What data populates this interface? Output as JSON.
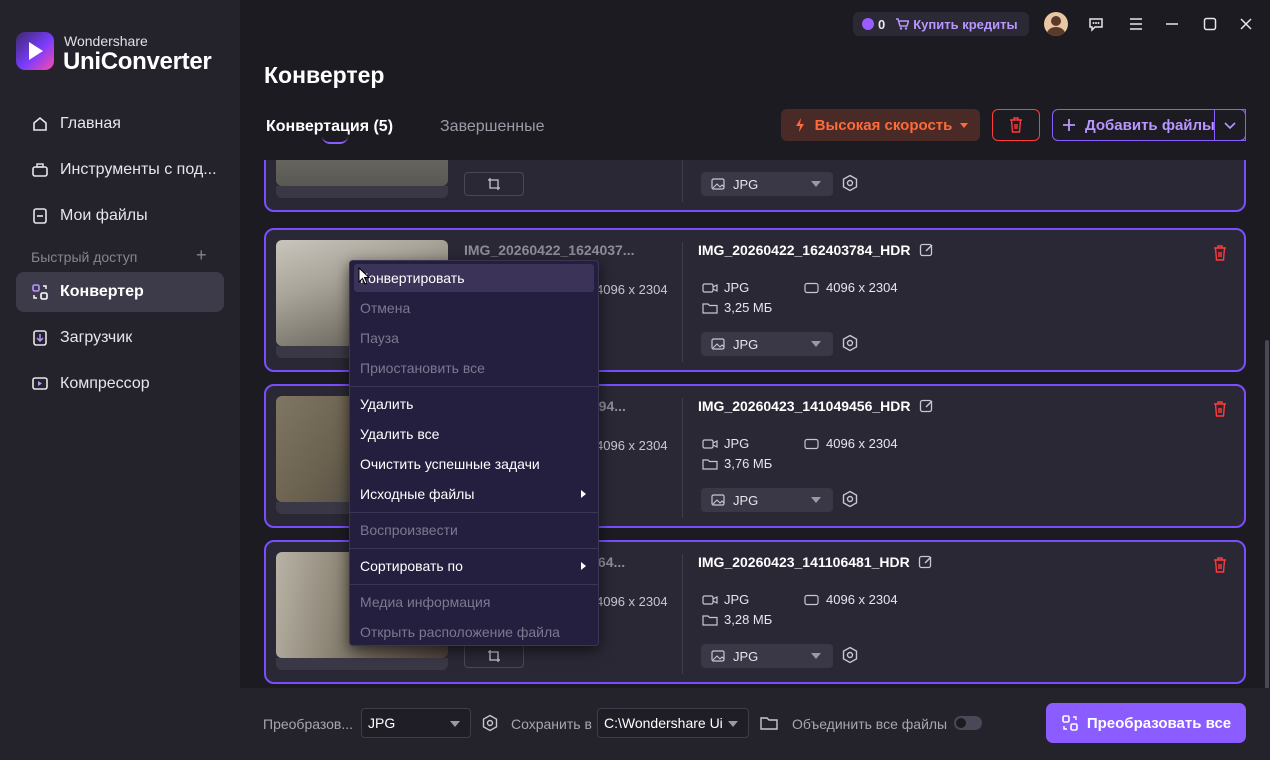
{
  "brand": {
    "line1": "Wondershare",
    "line2": "UniConverter"
  },
  "sidebar": {
    "items": [
      {
        "label": "Главная",
        "icon": "home-icon"
      },
      {
        "label": "Инструменты с под...",
        "icon": "toolbox-icon"
      },
      {
        "label": "Мои файлы",
        "icon": "files-icon"
      }
    ],
    "quick_access": "Быстрый доступ",
    "quick_items": [
      {
        "label": "Конвертер",
        "icon": "converter-icon",
        "active": true
      },
      {
        "label": "Загрузчик",
        "icon": "downloader-icon"
      },
      {
        "label": "Компрессор",
        "icon": "compressor-icon"
      }
    ]
  },
  "titlebar": {
    "credits": "0",
    "buy_label": "Купить кредиты"
  },
  "page": {
    "title": "Конвертер"
  },
  "tabs": [
    {
      "label": "Конвертация (5)"
    },
    {
      "label": "Завершенные"
    }
  ],
  "toolbar": {
    "speed_label": "Высокая скорость",
    "add_label": "Добавить файлы"
  },
  "cards": [
    {
      "src": "",
      "src_res": "",
      "out": "",
      "out_fmt": "",
      "out_res": "",
      "out_size": "",
      "format": "JPG"
    },
    {
      "src": "IMG_20260422_1624037...",
      "src_res": "4096 x 2304",
      "out": "IMG_20260422_162403784_HDR",
      "out_fmt": "JPG",
      "out_res": "4096 x 2304",
      "out_size": "3,25 МБ",
      "format": "JPG"
    },
    {
      "src": "IMG_20260423_110494...",
      "src_res": "4096 x 2304",
      "out": "IMG_20260423_141049456_HDR",
      "out_fmt": "JPG",
      "out_res": "4096 x 2304",
      "out_size": "3,76 МБ",
      "format": "JPG"
    },
    {
      "src": "IMG_20260423_111064...",
      "src_res": "4096 x 2304",
      "out": "IMG_20260423_141106481_HDR",
      "out_fmt": "JPG",
      "out_res": "4096 x 2304",
      "out_size": "3,28 МБ",
      "format": "JPG"
    }
  ],
  "context_menu": {
    "items": [
      {
        "label": "Конвертировать",
        "disabled": false
      },
      {
        "label": "Отмена",
        "disabled": true
      },
      {
        "label": "Пауза",
        "disabled": true
      },
      {
        "label": "Приостановить все",
        "disabled": true
      },
      {
        "label": "Удалить",
        "disabled": false
      },
      {
        "label": "Удалить все",
        "disabled": false
      },
      {
        "label": "Очистить успешные задачи",
        "disabled": false
      },
      {
        "label": "Исходные файлы",
        "disabled": false
      },
      {
        "label": "Воспроизвести",
        "disabled": true
      },
      {
        "label": "Сортировать по",
        "disabled": false
      },
      {
        "label": "Медиа информация",
        "disabled": true
      },
      {
        "label": "Открыть расположение файла",
        "disabled": true
      }
    ]
  },
  "bottom": {
    "convert_label": "Преобразов...",
    "convert_format": "JPG",
    "save_label": "Сохранить в",
    "save_path": "C:\\Wondershare Ui",
    "merge_label": "Объединить все файлы",
    "convert_all": "Преобразовать все"
  },
  "colors": {
    "accent": "#8b5cff",
    "danger": "#ff3b3b",
    "speed": "#ff6a3a"
  }
}
